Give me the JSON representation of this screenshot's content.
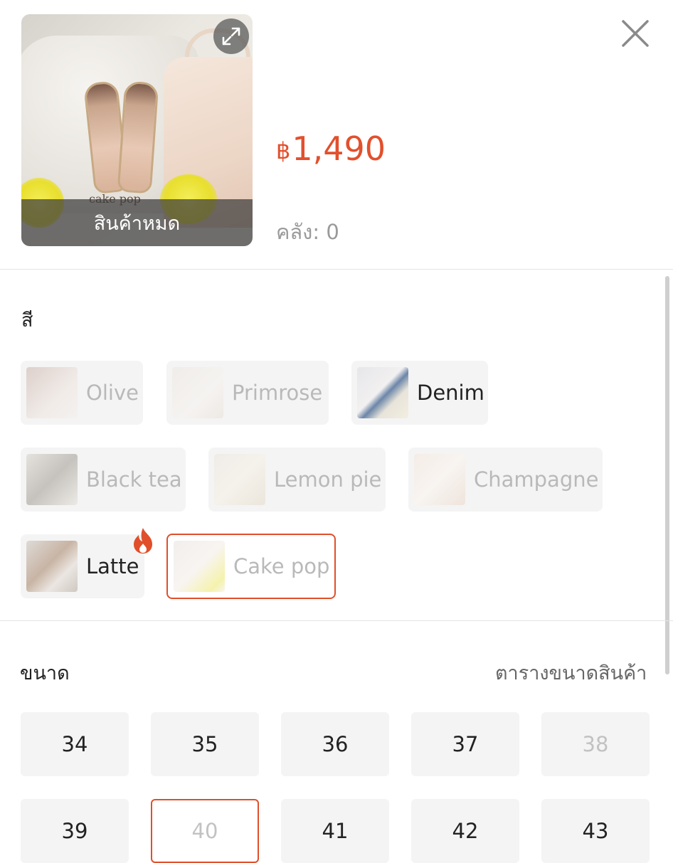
{
  "product": {
    "currency_symbol": "฿",
    "price": "1,490",
    "stock_text": "คลัง: 0",
    "out_of_stock_overlay": "สินค้าหมด",
    "thumbnail_caption": "cake pop",
    "price_color": "#e2502d"
  },
  "color_section": {
    "label": "สี",
    "options": [
      {
        "label": "Olive",
        "state": "disabled"
      },
      {
        "label": "Primrose",
        "state": "disabled"
      },
      {
        "label": "Denim",
        "state": "available"
      },
      {
        "label": "Black tea",
        "state": "disabled"
      },
      {
        "label": "Lemon pie",
        "state": "disabled"
      },
      {
        "label": "Champagne",
        "state": "disabled"
      },
      {
        "label": "Latte",
        "state": "available",
        "badge": "hot-icon"
      },
      {
        "label": "Cake pop",
        "state": "selected-unavailable"
      }
    ]
  },
  "size_section": {
    "label": "ขนาด",
    "size_chart_link": "ตารางขนาดสินค้า",
    "options": [
      {
        "label": "34",
        "state": "available"
      },
      {
        "label": "35",
        "state": "available"
      },
      {
        "label": "36",
        "state": "available"
      },
      {
        "label": "37",
        "state": "available"
      },
      {
        "label": "38",
        "state": "disabled"
      },
      {
        "label": "39",
        "state": "available"
      },
      {
        "label": "40",
        "state": "selected-unavailable"
      },
      {
        "label": "41",
        "state": "available"
      },
      {
        "label": "42",
        "state": "available"
      },
      {
        "label": "43",
        "state": "available"
      }
    ]
  },
  "accent_color": "#e04f2a"
}
